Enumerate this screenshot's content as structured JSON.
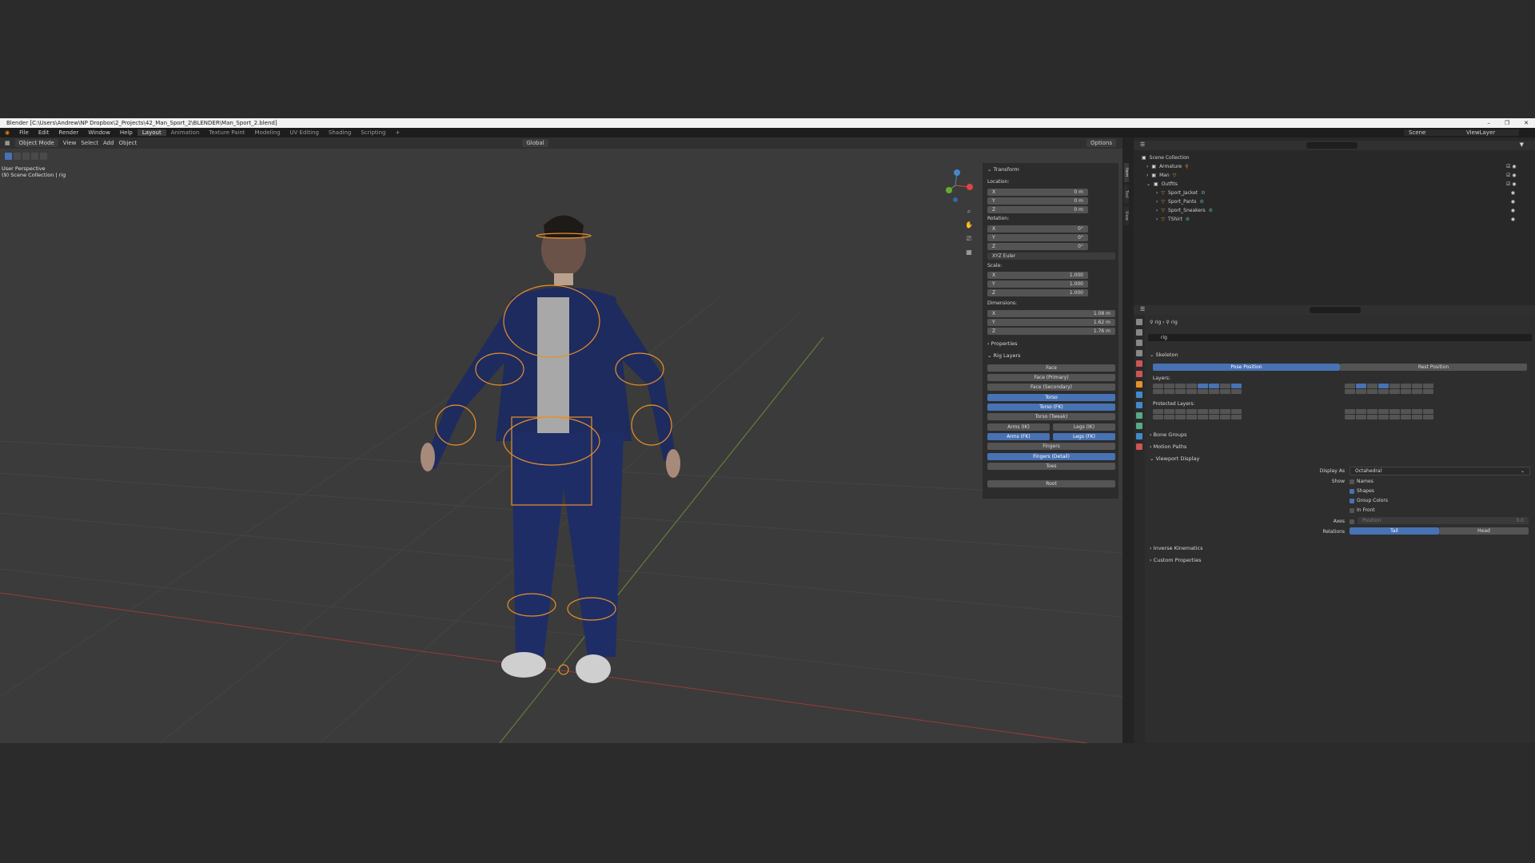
{
  "window": {
    "title": "Blender [C:\\Users\\Andrew\\NP Dropbox\\2_Projects\\42_Man_Sport_2\\BLENDER\\Man_Sport_2.blend]",
    "controls": [
      "–",
      "❐",
      "✕"
    ]
  },
  "menu": {
    "items": [
      "File",
      "Edit",
      "Render",
      "Window",
      "Help"
    ],
    "workspaces": [
      "Layout",
      "Animation",
      "Texture Paint",
      "Modeling",
      "UV Editing",
      "Shading",
      "Scripting",
      "+"
    ],
    "active_workspace": "Layout",
    "scene": "Scene",
    "view_layer": "ViewLayer"
  },
  "viewport": {
    "mode": "Object Mode",
    "menus": [
      "View",
      "Select",
      "Add",
      "Object"
    ],
    "orientation": "Global",
    "options_label": "Options",
    "info_line1": "User Perspective",
    "info_line2": "(9) Scene Collection | rig"
  },
  "npanel": {
    "tabs": [
      "Item",
      "Tool",
      "View"
    ],
    "transform_title": "Transform",
    "location_label": "Location:",
    "location": [
      {
        "axis": "X",
        "value": "0 m"
      },
      {
        "axis": "Y",
        "value": "0 m"
      },
      {
        "axis": "Z",
        "value": "0 m"
      }
    ],
    "rotation_label": "Rotation:",
    "rotation": [
      {
        "axis": "X",
        "value": "0°"
      },
      {
        "axis": "Y",
        "value": "0°"
      },
      {
        "axis": "Z",
        "value": "0°"
      }
    ],
    "rotation_mode": "XYZ Euler",
    "scale_label": "Scale:",
    "scale": [
      {
        "axis": "X",
        "value": "1.000"
      },
      {
        "axis": "Y",
        "value": "1.000"
      },
      {
        "axis": "Z",
        "value": "1.000"
      }
    ],
    "dimensions_label": "Dimensions:",
    "dimensions": [
      {
        "axis": "X",
        "value": "1.08 m"
      },
      {
        "axis": "Y",
        "value": "1.62 m"
      },
      {
        "axis": "Z",
        "value": "1.76 m"
      }
    ],
    "properties_title": "Properties",
    "rig_layers_title": "Rig Layers",
    "rig_layers": {
      "face": "Face",
      "face_primary": "Face (Primary)",
      "face_secondary": "Face (Secondary)",
      "torso": "Torso",
      "torso_fk": "Torso (FK)",
      "torso_tweak": "Torso (Tweak)",
      "arms_ik": "Arms (IK)",
      "legs_ik": "Legs (IK)",
      "arms_fk": "Arms (FK)",
      "legs_fk": "Legs (FK)",
      "fingers": "Fingers",
      "fingers_detail": "Fingers (Detail)",
      "toes": "Toes",
      "root": "Root"
    }
  },
  "outliner": {
    "root": "Scene Collection",
    "items": [
      {
        "name": "Armature",
        "indent": 1
      },
      {
        "name": "Man",
        "indent": 1
      },
      {
        "name": "Outfits",
        "indent": 1
      },
      {
        "name": "Sport_Jacket",
        "indent": 2
      },
      {
        "name": "Sport_Pants",
        "indent": 2
      },
      {
        "name": "Sport_Sneakers",
        "indent": 2
      },
      {
        "name": "TShirt",
        "indent": 2
      }
    ]
  },
  "properties": {
    "breadcrumb_obj": "rig",
    "breadcrumb_data": "rig",
    "data_name": "rig",
    "skeleton_title": "Skeleton",
    "pose_position": "Pose Position",
    "rest_position": "Rest Position",
    "layers_label": "Layers:",
    "protected_layers_label": "Protected Layers:",
    "bone_groups": "Bone Groups",
    "motion_paths": "Motion Paths",
    "viewport_display": "Viewport Display",
    "display_as_label": "Display As",
    "display_as_value": "Octahedral",
    "show_label": "Show",
    "show_names": "Names",
    "show_shapes": "Shapes",
    "show_group_colors": "Group Colors",
    "show_in_front": "In Front",
    "axes_label": "Axes",
    "axes_position": "Position",
    "axes_value": "0.0",
    "relations_label": "Relations",
    "relations_tail": "Tail",
    "relations_head": "Head",
    "inverse_kinematics": "Inverse Kinematics",
    "custom_properties": "Custom Properties"
  },
  "colors": {
    "accent": "#4772b3",
    "rig_wire": "#e8902a",
    "background": "#3b3b3b"
  }
}
